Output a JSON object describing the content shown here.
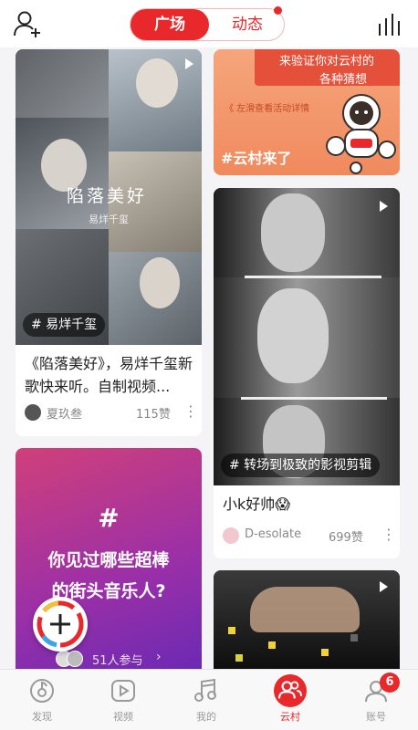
{
  "header": {
    "tab_active": "广场",
    "tab_inactive": "动态"
  },
  "feed": {
    "card1": {
      "photo_text": "陷落美好",
      "photo_caption": "易烊千玺",
      "tag": "# 易烊千玺",
      "title": "《陷落美好》，易烊千玺新歌快来听。自制视频...",
      "author": "夏玖叁",
      "likes": "115赞"
    },
    "card2": {
      "banner_line1": "来验证你对云村的",
      "banner_line2": "各种猜想",
      "banner_sub": "《 左滑查看活动详情",
      "tag": "#云村来了"
    },
    "card3": {
      "symbol": "#",
      "line1": "你见过哪些超棒",
      "line2": "的街头音乐人?",
      "participants": "51人参与"
    },
    "card4": {
      "tag": "# 转场到极致的影视剪辑",
      "title": "小k好帅😱",
      "author": "D-esolate",
      "likes": "699赞"
    }
  },
  "nav": {
    "items": [
      {
        "label": "发现"
      },
      {
        "label": "视频"
      },
      {
        "label": "我的"
      },
      {
        "label": "云村"
      },
      {
        "label": "账号"
      }
    ],
    "badge": "6"
  },
  "colors": {
    "accent": "#e8282b",
    "muted": "#9a9a9a"
  }
}
